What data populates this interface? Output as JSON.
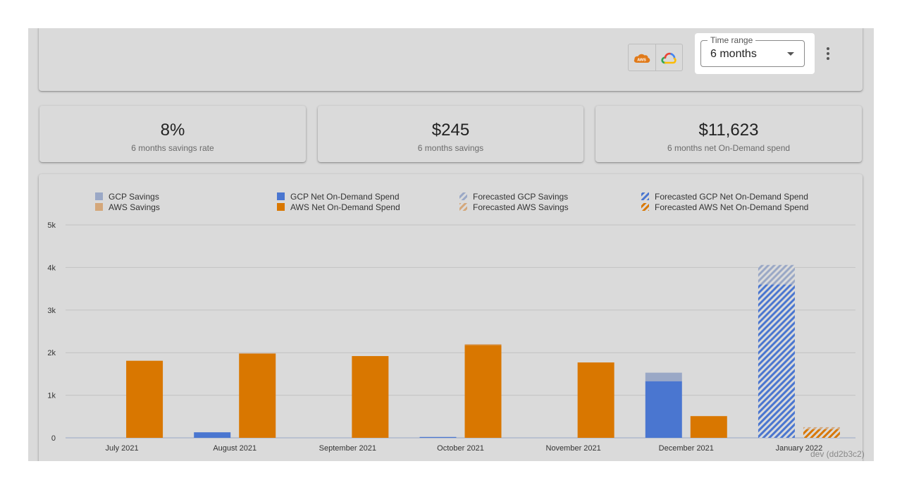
{
  "toolbar": {
    "providers": [
      {
        "name": "AWS",
        "icon": "aws-cloud-icon",
        "color": "#e07a1a"
      },
      {
        "name": "GCP",
        "icon": "google-cloud-icon"
      }
    ],
    "time_range": {
      "label": "Time range",
      "value": "6 months"
    },
    "more_icon": "more-vert-icon"
  },
  "stats": [
    {
      "value": "8%",
      "label": "6 months savings rate"
    },
    {
      "value": "$245",
      "label": "6 months savings"
    },
    {
      "value": "$11,623",
      "label": "6 months net On-Demand spend"
    }
  ],
  "chart_data": {
    "type": "bar",
    "stacked": true,
    "categories": [
      "July 2021",
      "August 2021",
      "September 2021",
      "October 2021",
      "November 2021",
      "December 2021",
      "January 2022"
    ],
    "ylim": [
      0,
      5000
    ],
    "yticks": [
      "0",
      "1k",
      "2k",
      "3k",
      "4k",
      "5k"
    ],
    "grid": true,
    "legend_position": "top",
    "legend": [
      {
        "name": "GCP Savings",
        "color": "#9aa8c6",
        "pattern": false
      },
      {
        "name": "AWS Savings",
        "color": "#d4a77a",
        "pattern": false
      },
      {
        "name": "GCP Net On-Demand Spend",
        "color": "#4a76d0",
        "pattern": false
      },
      {
        "name": "AWS Net On-Demand Spend",
        "color": "#d97700",
        "pattern": false
      },
      {
        "name": "Forecasted GCP Savings",
        "color": "#9aa8c6",
        "pattern": true
      },
      {
        "name": "Forecasted AWS Savings",
        "color": "#d4a77a",
        "pattern": true
      },
      {
        "name": "Forecasted GCP Net On-Demand Spend",
        "color": "#4a76d0",
        "pattern": true
      },
      {
        "name": "Forecasted AWS Net On-Demand Spend",
        "color": "#d97700",
        "pattern": true
      }
    ],
    "series": [
      {
        "name": "GCP Net On-Demand Spend",
        "values": [
          0,
          130,
          0,
          20,
          0,
          1330,
          null
        ]
      },
      {
        "name": "GCP Savings",
        "values": [
          0,
          0,
          0,
          0,
          0,
          200,
          null
        ]
      },
      {
        "name": "AWS Net On-Demand Spend",
        "values": [
          1810,
          1980,
          1920,
          2180,
          1770,
          510,
          null
        ]
      },
      {
        "name": "AWS Savings",
        "values": [
          0,
          10,
          0,
          20,
          0,
          0,
          null
        ]
      },
      {
        "name": "Forecasted GCP Net On-Demand Spend",
        "values": [
          null,
          null,
          null,
          null,
          null,
          null,
          3600
        ]
      },
      {
        "name": "Forecasted GCP Savings",
        "values": [
          null,
          null,
          null,
          null,
          null,
          null,
          460
        ]
      },
      {
        "name": "Forecasted AWS Net On-Demand Spend",
        "values": [
          null,
          null,
          null,
          null,
          null,
          null,
          200
        ]
      },
      {
        "name": "Forecasted AWS Savings",
        "values": [
          null,
          null,
          null,
          null,
          null,
          null,
          50
        ]
      }
    ]
  },
  "footer": {
    "text": "dev (dd2b3c2)"
  }
}
